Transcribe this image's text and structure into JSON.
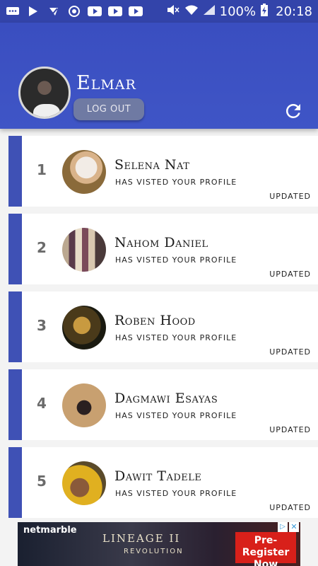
{
  "status_bar": {
    "battery": "100%",
    "time": "20:18"
  },
  "header": {
    "username": "Elmar",
    "logout_label": "LOG OUT"
  },
  "visitors": [
    {
      "rank": "1",
      "name": "Selena Nat",
      "subtitle": "HAS VISTED YOUR PROFILE",
      "status": "UPDATED"
    },
    {
      "rank": "2",
      "name": "Nahom Daniel",
      "subtitle": "HAS VISTED YOUR PROFILE",
      "status": "UPDATED"
    },
    {
      "rank": "3",
      "name": "Roben Hood",
      "subtitle": "HAS VISTED YOUR PROFILE",
      "status": "UPDATED"
    },
    {
      "rank": "4",
      "name": "Dagmawi Esayas",
      "subtitle": "HAS VISTED YOUR PROFILE",
      "status": "UPDATED"
    },
    {
      "rank": "5",
      "name": "Dawit Tadele",
      "subtitle": "HAS VISTED YOUR PROFILE",
      "status": "UPDATED"
    }
  ],
  "ad": {
    "brand": "netmarble",
    "game": "LINEAGE II",
    "game_sub": "REVOLUTION",
    "cta": "Pre-Register Now"
  },
  "colors": {
    "primary": "#3f51b5",
    "status_bar": "#3344aa",
    "logout_button": "#6f7aa3"
  }
}
